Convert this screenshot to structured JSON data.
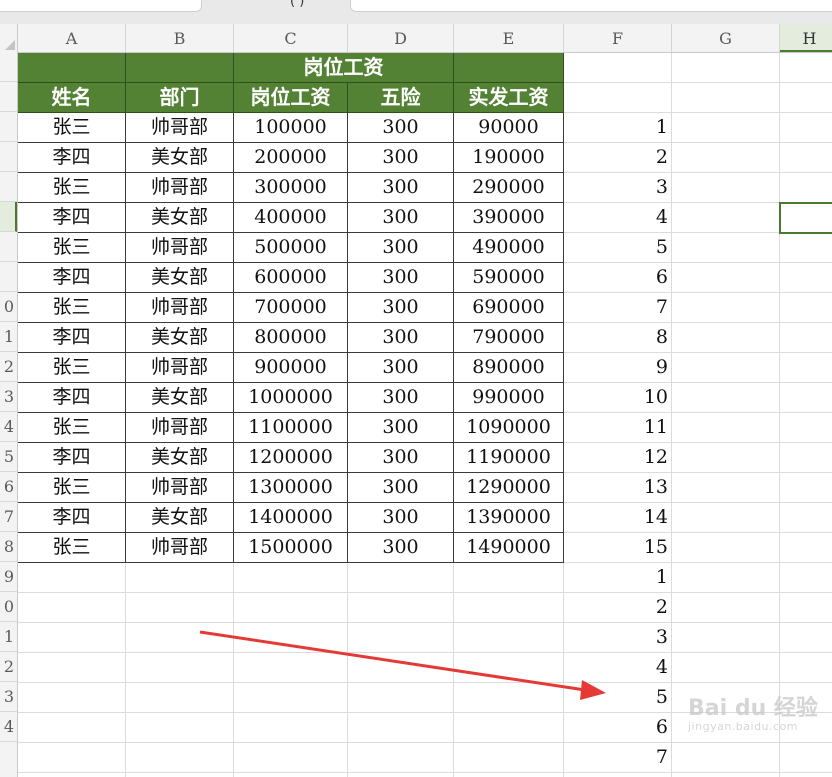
{
  "top_tab_text": "( )",
  "columns": [
    "A",
    "B",
    "C",
    "D",
    "E",
    "F",
    "G",
    "H"
  ],
  "rows": [
    "",
    "",
    "",
    "",
    "",
    "",
    "",
    "",
    "0",
    "1",
    "2",
    "3",
    "4",
    "5",
    "6",
    "7",
    "8",
    "9",
    "0",
    "1",
    "2",
    "3",
    "4"
  ],
  "table": {
    "merged_header": "岗位工资",
    "headers": [
      "姓名",
      "部门",
      "岗位工资",
      "五险",
      "实发工资"
    ],
    "records": [
      [
        "张三",
        "帅哥部",
        "100000",
        "300",
        "90000"
      ],
      [
        "李四",
        "美女部",
        "200000",
        "300",
        "190000"
      ],
      [
        "张三",
        "帅哥部",
        "300000",
        "300",
        "290000"
      ],
      [
        "李四",
        "美女部",
        "400000",
        "300",
        "390000"
      ],
      [
        "张三",
        "帅哥部",
        "500000",
        "300",
        "490000"
      ],
      [
        "李四",
        "美女部",
        "600000",
        "300",
        "590000"
      ],
      [
        "张三",
        "帅哥部",
        "700000",
        "300",
        "690000"
      ],
      [
        "李四",
        "美女部",
        "800000",
        "300",
        "790000"
      ],
      [
        "张三",
        "帅哥部",
        "900000",
        "300",
        "890000"
      ],
      [
        "李四",
        "美女部",
        "1000000",
        "300",
        "990000"
      ],
      [
        "张三",
        "帅哥部",
        "1100000",
        "300",
        "1090000"
      ],
      [
        "李四",
        "美女部",
        "1200000",
        "300",
        "1190000"
      ],
      [
        "张三",
        "帅哥部",
        "1300000",
        "300",
        "1290000"
      ],
      [
        "李四",
        "美女部",
        "1400000",
        "300",
        "1390000"
      ],
      [
        "张三",
        "帅哥部",
        "1500000",
        "300",
        "1490000"
      ]
    ]
  },
  "column_f_numbers": [
    "1",
    "2",
    "3",
    "4",
    "5",
    "6",
    "7",
    "8",
    "9",
    "10",
    "11",
    "12",
    "13",
    "14",
    "15",
    "1",
    "2",
    "3",
    "4",
    "5",
    "6",
    "7"
  ],
  "watermark": {
    "logo": "Bai du 经验",
    "url": "jingyan.baidu.com"
  },
  "colors": {
    "header_fill": "#548235",
    "selection": "#4a7a2f",
    "arrow": "#e53935"
  }
}
